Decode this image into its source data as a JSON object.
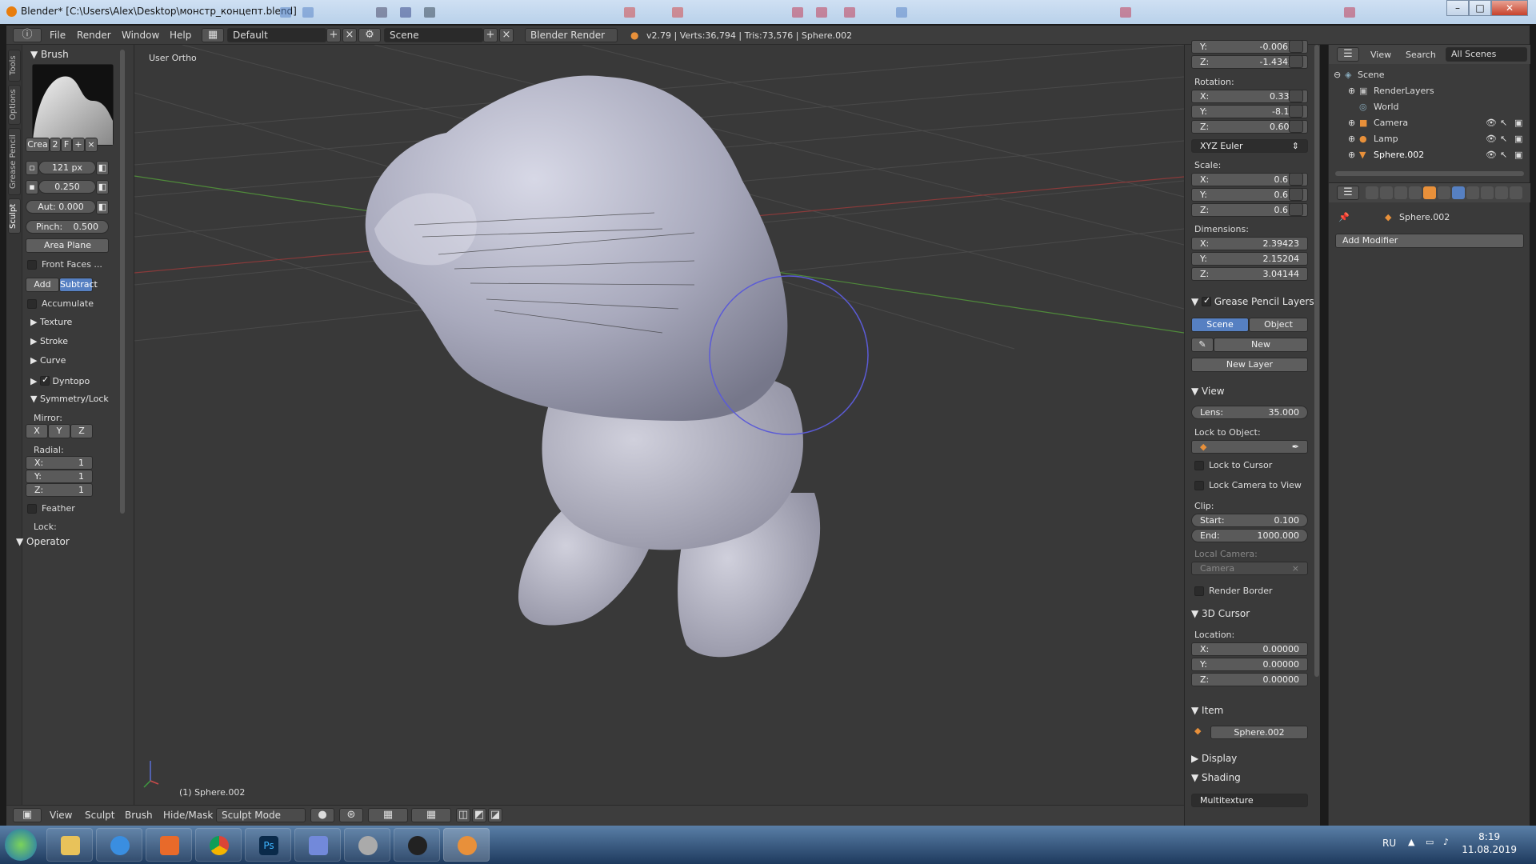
{
  "window": {
    "title": "Blender* [C:\\Users\\Alex\\Desktop\\монстр_концепт.blend]"
  },
  "info": {
    "menus": [
      "File",
      "Render",
      "Window",
      "Help"
    ],
    "screen_layout": "Default",
    "scene": "Scene",
    "engine": "Blender Render",
    "stats": "v2.79 | Verts:36,794 | Tris:73,576 | Sphere.002"
  },
  "tool_tabs": [
    "Tools",
    "Options",
    "Grease Pencil",
    "Sculpt"
  ],
  "toolshelf": {
    "brush_title": "Brush",
    "brush_name": "Crea",
    "brush_users": "2",
    "brush_fake": "F",
    "radius": "121 px",
    "strength": "0.250",
    "autosmooth": "Aut: 0.000",
    "pinch": "Pinch:",
    "pinch_val": "0.500",
    "sculpt_plane": "Area Plane",
    "front_faces": "Front Faces ...",
    "add": "Add",
    "subtract": "Subtract",
    "accumulate": "Accumulate",
    "texture": "Texture",
    "stroke": "Stroke",
    "curve": "Curve",
    "dyntopo": "Dyntopo",
    "symmetry": "Symmetry/Lock",
    "mirror": "Mirror:",
    "mirror_axes": [
      "X",
      "Y",
      "Z"
    ],
    "radial": "Radial:",
    "radial_values": [
      {
        "k": "X:",
        "v": "1"
      },
      {
        "k": "Y:",
        "v": "1"
      },
      {
        "k": "Z:",
        "v": "1"
      }
    ],
    "feather": "Feather",
    "lock": "Lock:",
    "operator": "Operator"
  },
  "viewport": {
    "view_name": "User Ortho",
    "object_label": "(1) Sphere.002"
  },
  "viewport_header": {
    "menus": [
      "View",
      "Sculpt",
      "Brush",
      "Hide/Mask"
    ],
    "mode": "Sculpt Mode"
  },
  "npanel": {
    "location_rows": [
      {
        "k": "Y:",
        "v": "-0.00626"
      },
      {
        "k": "Z:",
        "v": "-1.43420"
      }
    ],
    "rotation_label": "Rotation:",
    "rotation_rows": [
      {
        "k": "X:",
        "v": "0.334°"
      },
      {
        "k": "Y:",
        "v": "-8.13°"
      },
      {
        "k": "Z:",
        "v": "0.605°"
      }
    ],
    "rotation_mode": "XYZ Euler",
    "scale_label": "Scale:",
    "scale_rows": [
      {
        "k": "X:",
        "v": "0.615"
      },
      {
        "k": "Y:",
        "v": "0.615"
      },
      {
        "k": "Z:",
        "v": "0.615"
      }
    ],
    "dimensions_label": "Dimensions:",
    "dimension_rows": [
      {
        "k": "X:",
        "v": "2.39423"
      },
      {
        "k": "Y:",
        "v": "2.15204"
      },
      {
        "k": "Z:",
        "v": "3.04144"
      }
    ],
    "grease_pencil": "Grease Pencil Layers",
    "gp_scene": "Scene",
    "gp_object": "Object",
    "gp_new": "New",
    "gp_new_layer": "New Layer",
    "view": "View",
    "lens_k": "Lens:",
    "lens_v": "35.000",
    "lock_to_object": "Lock to Object:",
    "lock_to_cursor": "Lock to Cursor",
    "lock_camera": "Lock Camera to View",
    "clip": "Clip:",
    "clip_start_k": "Start:",
    "clip_start_v": "0.100",
    "clip_end_k": "End:",
    "clip_end_v": "1000.000",
    "local_camera": "Local Camera:",
    "camera": "Camera",
    "render_border": "Render Border",
    "cursor3d": "3D Cursor",
    "location": "Location:",
    "cursor_rows": [
      {
        "k": "X:",
        "v": "0.00000"
      },
      {
        "k": "Y:",
        "v": "0.00000"
      },
      {
        "k": "Z:",
        "v": "0.00000"
      }
    ],
    "item": "Item",
    "item_name": "Sphere.002",
    "display": "Display",
    "shading": "Shading",
    "shading_mode": "Multitexture"
  },
  "outliner": {
    "view": "View",
    "search": "Search",
    "filter": "All Scenes",
    "items": [
      {
        "label": "Scene"
      },
      {
        "label": "RenderLayers"
      },
      {
        "label": "World"
      },
      {
        "label": "Camera"
      },
      {
        "label": "Lamp"
      },
      {
        "label": "Sphere.002"
      }
    ]
  },
  "properties": {
    "object": "Sphere.002",
    "add_modifier": "Add Modifier"
  },
  "taskbar": {
    "lang": "RU",
    "time": "8:19",
    "date": "11.08.2019"
  },
  "colors": {
    "accent_blue": "#5680c2",
    "brush_circle": "#5b5bd6",
    "mesh": "#b7b8c8"
  }
}
